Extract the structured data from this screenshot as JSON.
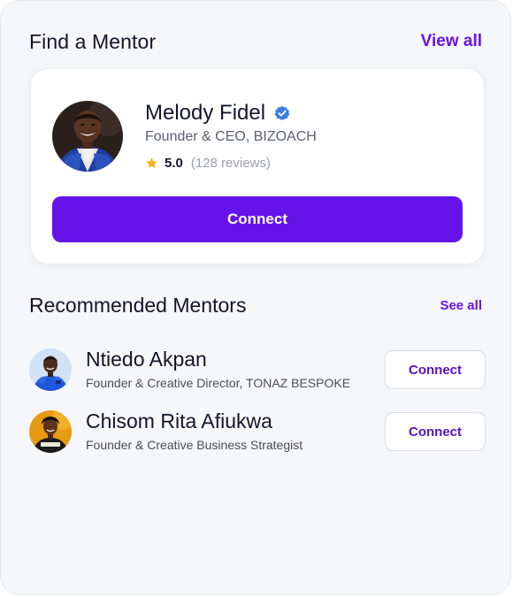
{
  "find_section": {
    "title": "Find a Mentor",
    "view_all_label": "View all"
  },
  "featured_mentor": {
    "name": "Melody Fidel",
    "role": "Founder & CEO, BIZOACH",
    "rating": "5.0",
    "reviews": "(128 reviews)",
    "connect_label": "Connect",
    "verified_icon": "verified-badge-icon"
  },
  "recommended_section": {
    "title": "Recommended Mentors",
    "see_all_label": "See all",
    "mentors": [
      {
        "name": "Ntiedo Akpan",
        "role": "Founder & Creative Director, TONAZ BESPOKE",
        "connect_label": "Connect"
      },
      {
        "name": "Chisom Rita Afiukwa",
        "role": "Founder & Creative Business Strategist",
        "connect_label": "Connect"
      }
    ]
  },
  "colors": {
    "accent": "#6613ea",
    "star": "#f2b316",
    "verified": "#3d7be6",
    "background": "#f6f7fa"
  }
}
